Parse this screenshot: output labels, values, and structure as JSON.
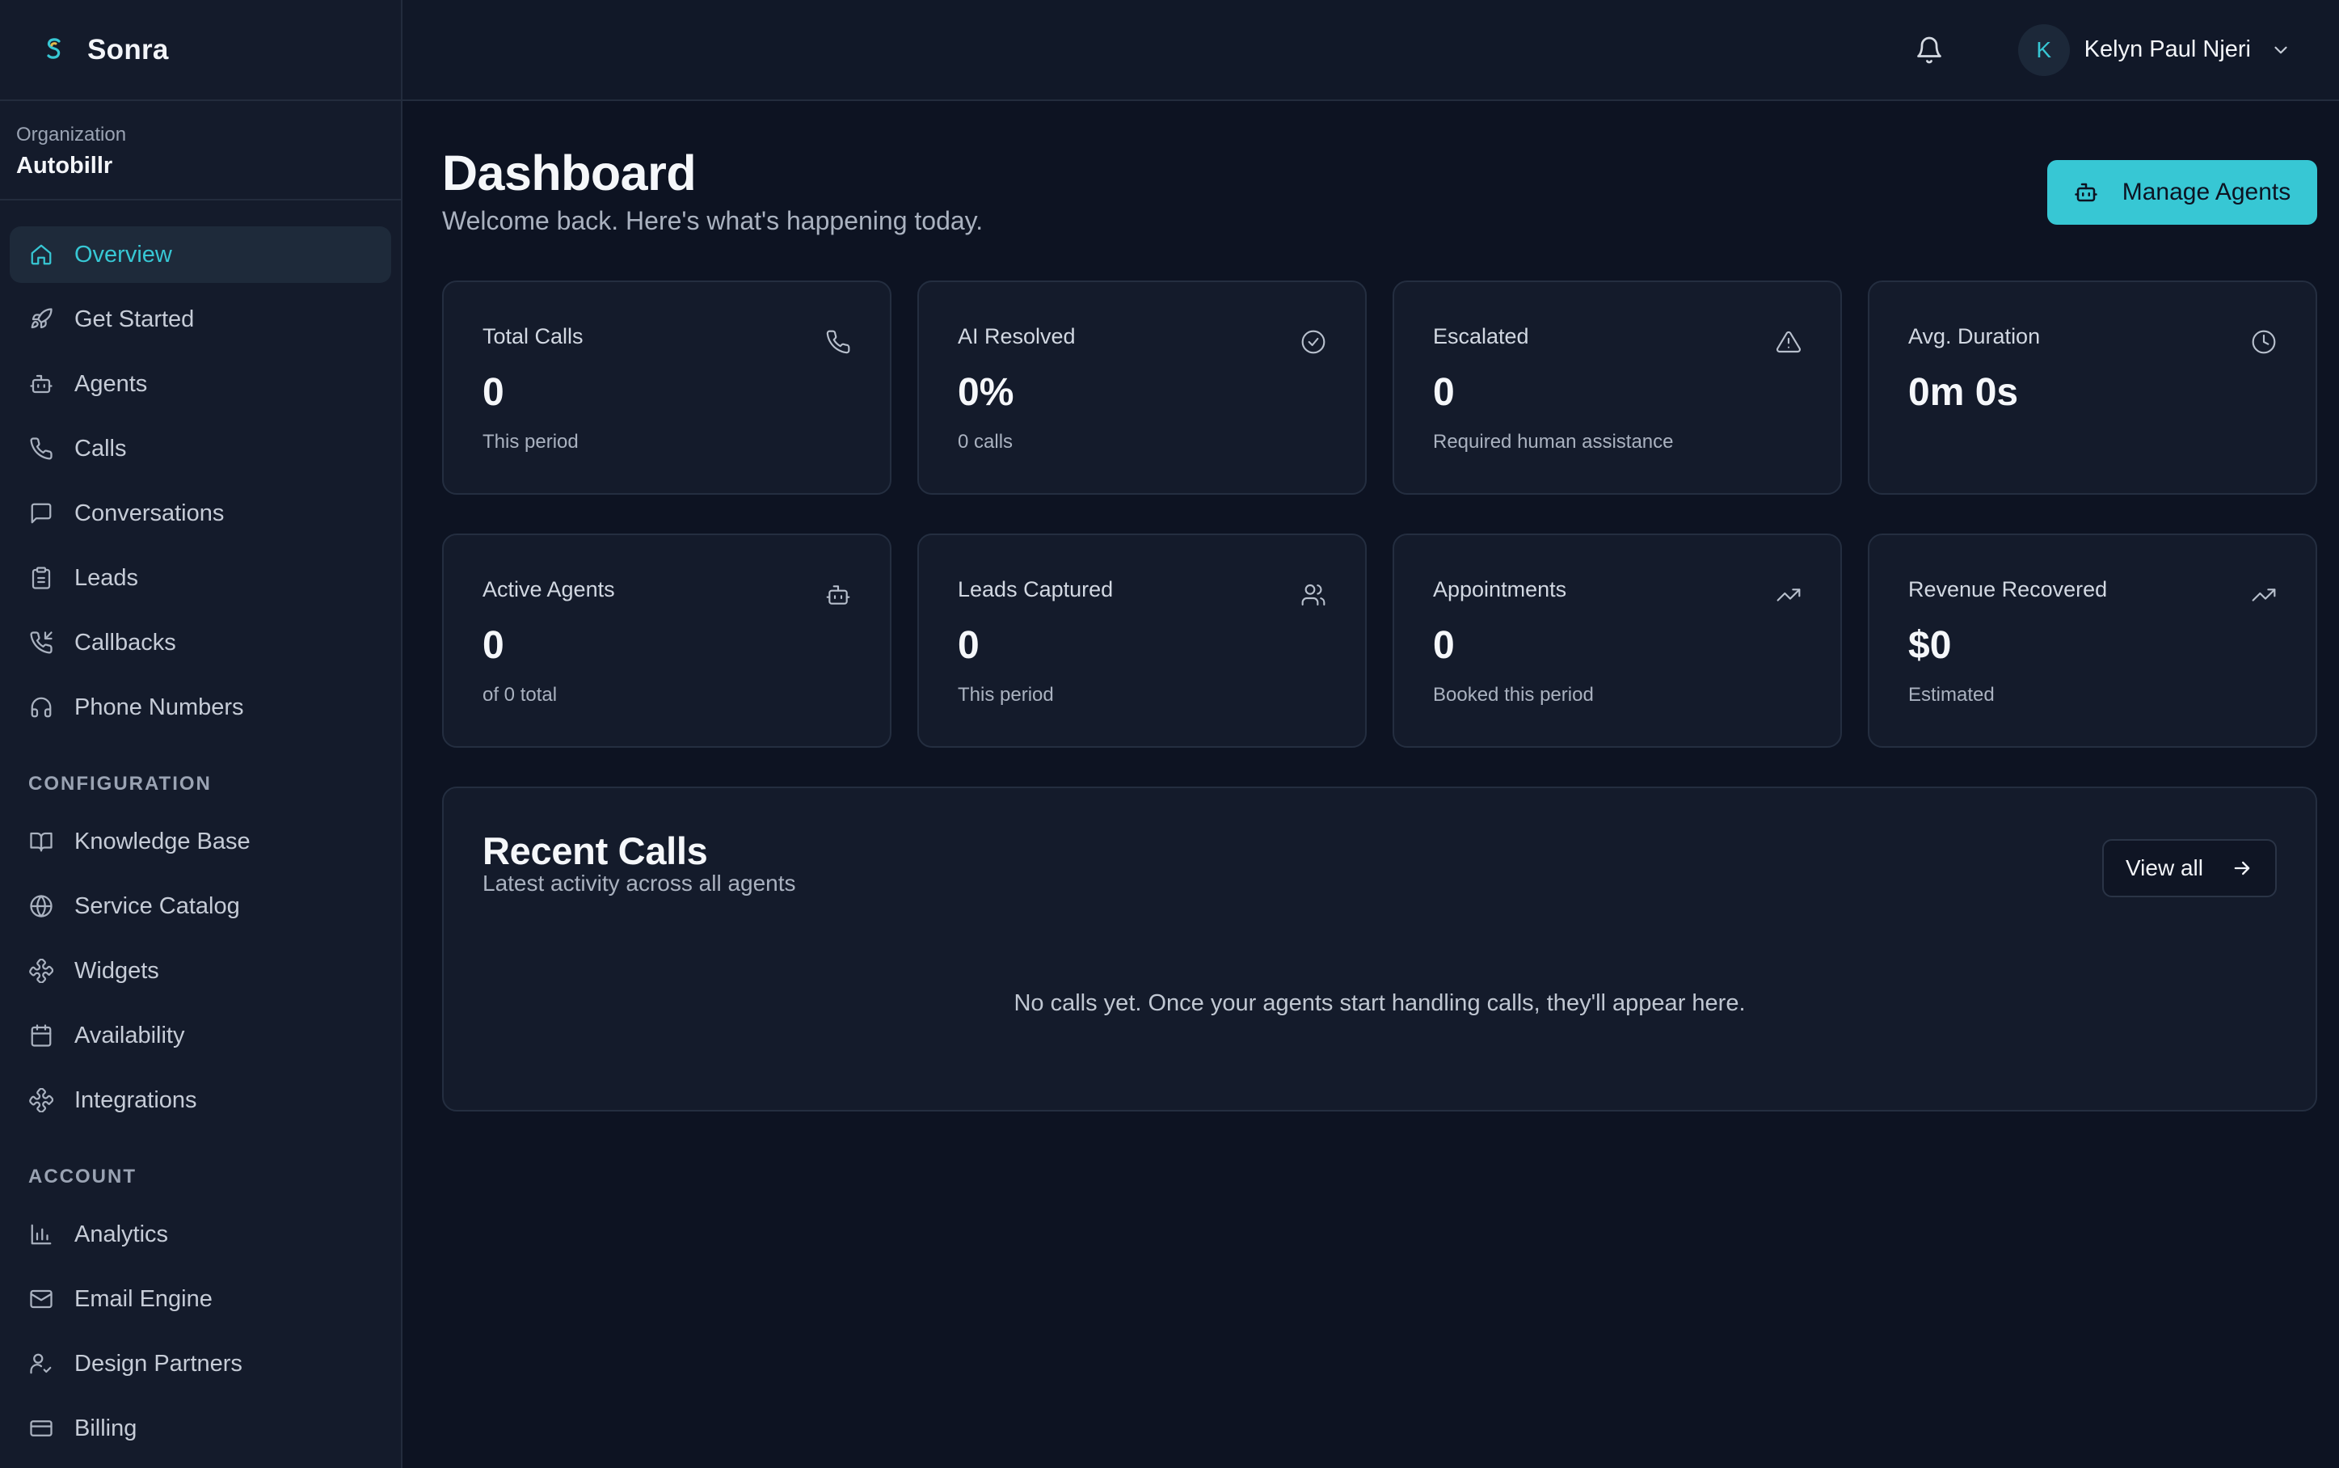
{
  "brand": {
    "name": "Sonra"
  },
  "organization": {
    "label": "Organization",
    "name": "Autobillr"
  },
  "nav": {
    "main": [
      {
        "label": "Overview",
        "icon": "home-icon"
      },
      {
        "label": "Get Started",
        "icon": "rocket-icon"
      },
      {
        "label": "Agents",
        "icon": "bot-icon"
      },
      {
        "label": "Calls",
        "icon": "phone-icon"
      },
      {
        "label": "Conversations",
        "icon": "message-icon"
      },
      {
        "label": "Leads",
        "icon": "clipboard-icon"
      },
      {
        "label": "Callbacks",
        "icon": "phone-callback-icon"
      },
      {
        "label": "Phone Numbers",
        "icon": "headphones-icon"
      }
    ],
    "configuration_title": "CONFIGURATION",
    "configuration": [
      {
        "label": "Knowledge Base",
        "icon": "book-icon"
      },
      {
        "label": "Service Catalog",
        "icon": "globe-icon"
      },
      {
        "label": "Widgets",
        "icon": "puzzle-icon"
      },
      {
        "label": "Availability",
        "icon": "calendar-icon"
      },
      {
        "label": "Integrations",
        "icon": "puzzle-icon"
      }
    ],
    "account_title": "ACCOUNT",
    "account": [
      {
        "label": "Analytics",
        "icon": "bar-chart-icon"
      },
      {
        "label": "Email Engine",
        "icon": "mail-icon"
      },
      {
        "label": "Design Partners",
        "icon": "user-check-icon"
      },
      {
        "label": "Billing",
        "icon": "credit-card-icon"
      }
    ]
  },
  "topbar": {
    "user": {
      "initial": "K",
      "name": "Kelyn Paul Njeri"
    }
  },
  "page": {
    "title": "Dashboard",
    "subtitle": "Welcome back. Here's what's happening today.",
    "primary_action": "Manage Agents"
  },
  "stats": [
    {
      "label": "Total Calls",
      "value": "0",
      "sub": "This period",
      "icon": "phone-icon"
    },
    {
      "label": "AI Resolved",
      "value": "0%",
      "sub": "0 calls",
      "icon": "check-circle-icon"
    },
    {
      "label": "Escalated",
      "value": "0",
      "sub": "Required human assistance",
      "icon": "alert-triangle-icon"
    },
    {
      "label": "Avg. Duration",
      "value": "0m 0s",
      "sub": "",
      "icon": "clock-icon"
    },
    {
      "label": "Active Agents",
      "value": "0",
      "sub": "of 0 total",
      "icon": "bot-icon"
    },
    {
      "label": "Leads Captured",
      "value": "0",
      "sub": "This period",
      "icon": "users-icon"
    },
    {
      "label": "Appointments",
      "value": "0",
      "sub": "Booked this period",
      "icon": "trending-up-icon"
    },
    {
      "label": "Revenue Recovered",
      "value": "$0",
      "sub": "Estimated",
      "icon": "trending-up-icon"
    }
  ],
  "recent_calls": {
    "title": "Recent Calls",
    "subtitle": "Latest activity across all agents",
    "view_all": "View all",
    "empty": "No calls yet. Once your agents start handling calls, they'll appear here."
  },
  "colors": {
    "accent": "#37c7d4",
    "background": "#0d1322",
    "panel": "#141b2b"
  }
}
